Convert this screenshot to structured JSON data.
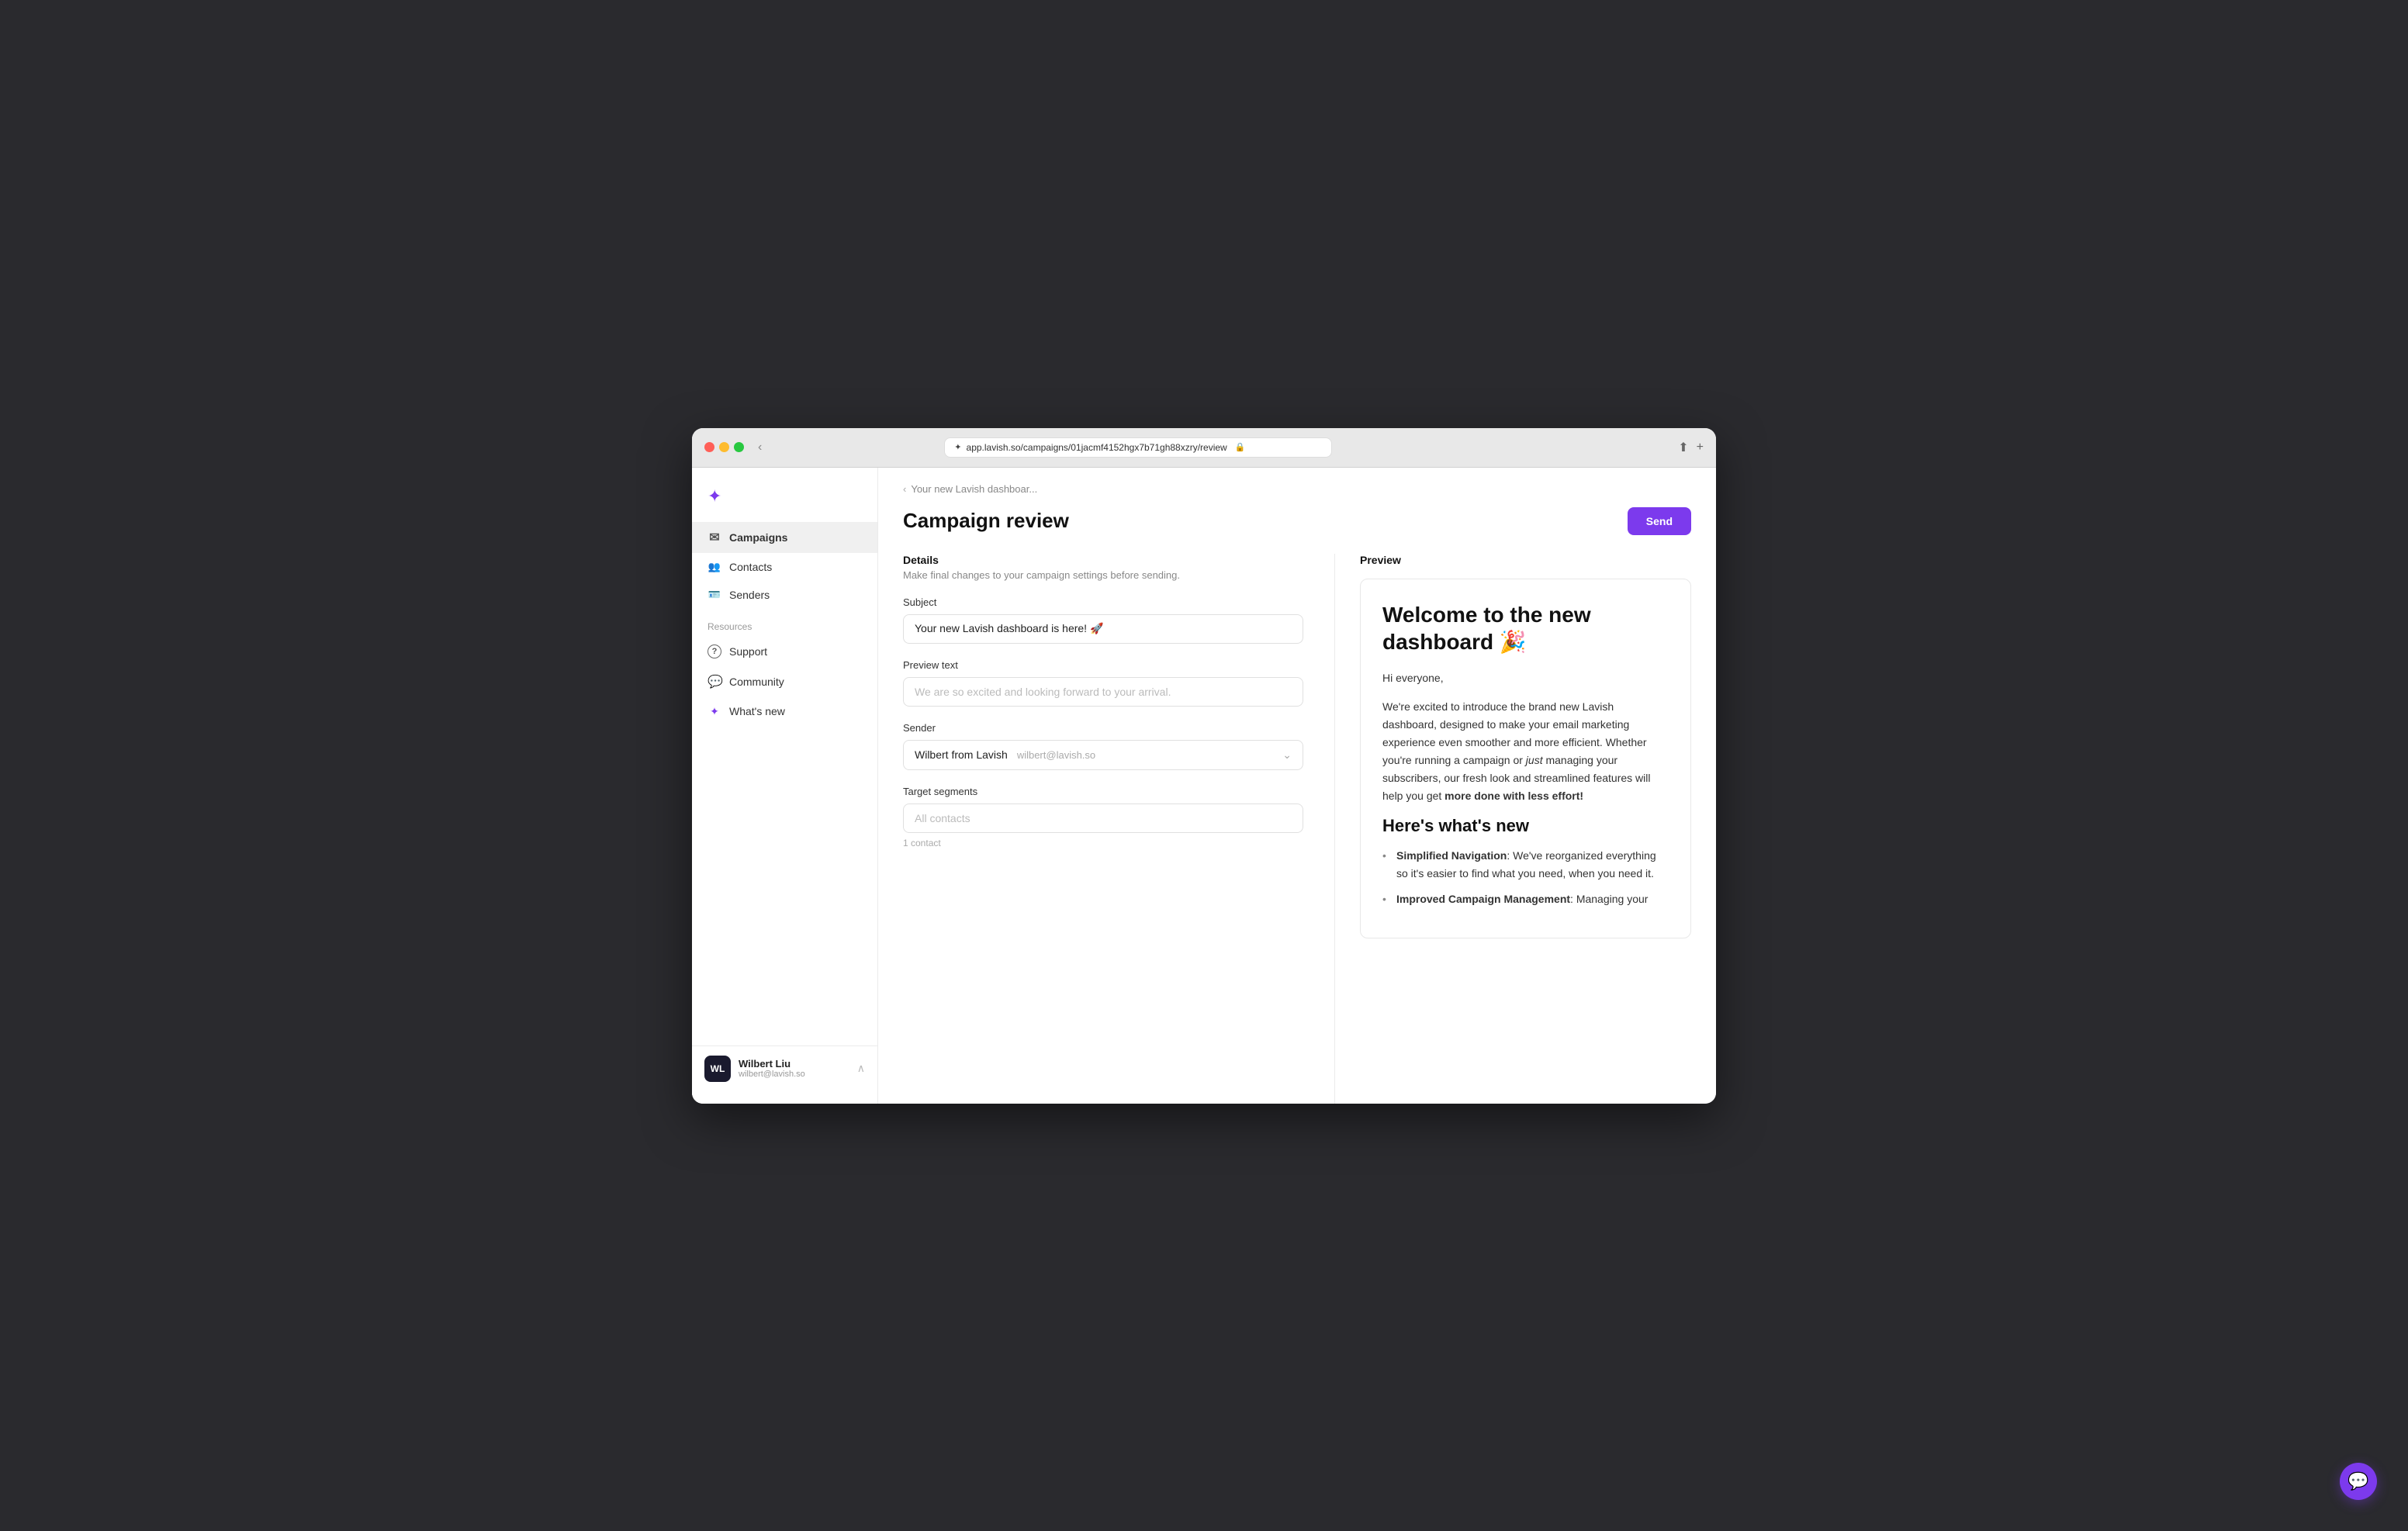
{
  "browser": {
    "url": "app.lavish.so/campaigns/01jacmf4152hgx7b71gh88xzry/review",
    "back_label": "‹"
  },
  "sidebar": {
    "logo_icon": "✦",
    "nav": [
      {
        "id": "campaigns",
        "label": "Campaigns",
        "icon": "✉"
      },
      {
        "id": "contacts",
        "label": "Contacts",
        "icon": "👥"
      },
      {
        "id": "senders",
        "label": "Senders",
        "icon": "🪪"
      }
    ],
    "resources_label": "Resources",
    "resources": [
      {
        "id": "support",
        "label": "Support",
        "icon": "?"
      },
      {
        "id": "community",
        "label": "Community",
        "icon": "💬"
      },
      {
        "id": "whats-new",
        "label": "What's new",
        "icon": "✦"
      }
    ],
    "user": {
      "initials": "WL",
      "name": "Wilbert Liu",
      "email": "wilbert@lavish.so"
    }
  },
  "page": {
    "breadcrumb": "Your new Lavish dashboar...",
    "title": "Campaign review",
    "send_button": "Send"
  },
  "details": {
    "panel_title": "Details",
    "panel_desc": "Make final changes to your campaign settings before sending.",
    "subject_label": "Subject",
    "subject_value": "Your new Lavish dashboard is here! 🚀",
    "preview_text_label": "Preview text",
    "preview_text_placeholder": "We are so excited and looking forward to your arrival.",
    "sender_label": "Sender",
    "sender_name": "Wilbert from Lavish",
    "sender_email": "wilbert@lavish.so",
    "target_label": "Target segments",
    "target_placeholder": "All contacts",
    "contact_count": "1 contact"
  },
  "preview": {
    "panel_title": "Preview",
    "email": {
      "heading": "Welcome to the new dashboard 🎉",
      "greeting": "Hi everyone,",
      "body1": "We're excited to introduce the brand new Lavish dashboard, designed to make your email marketing experience even smoother and more efficient. Whether you're running a campaign or just managing your subscribers, our fresh look and streamlined features will help you get more done with less effort!",
      "section_title": "Here's what's new",
      "list": [
        {
          "bold": "Simplified Navigation",
          "text": ": We've reorganized everything so it's easier to find what you need, when you need it."
        },
        {
          "bold": "Improved Campaign Management",
          "text": ": Managing your"
        }
      ]
    }
  }
}
